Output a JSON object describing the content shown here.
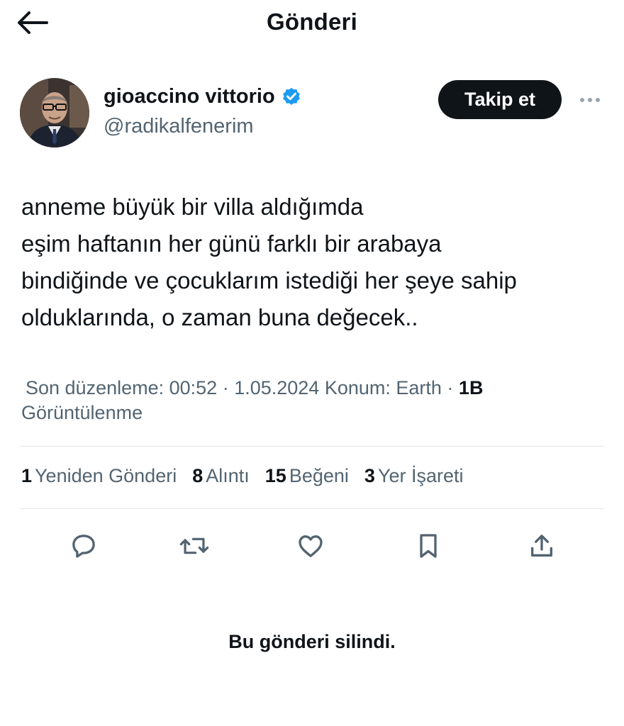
{
  "header": {
    "title": "Gönderi",
    "back_icon": "arrow-left-icon"
  },
  "author": {
    "name": "gioaccino vittorio",
    "handle": "@radikalfenerim",
    "verified_icon": "verified-badge-icon",
    "verified_color": "#1d9bf0",
    "follow_label": "Takip et",
    "more_icon": "more-horizontal-icon"
  },
  "tweet": {
    "lines": [
      "anneme büyük bir villa aldığımda",
      "eşim haftanın her günü farklı bir arabaya",
      "bindiğinde ve çocuklarım istediği her şeye sahip",
      "olduklarında, o zaman buna değecek.."
    ]
  },
  "meta": {
    "edited": "Son düzenleme: 00:52 · 1.05.2024",
    "location": "Konum: Earth ·",
    "views_count": "1B",
    "views_label": "Görüntülenme"
  },
  "stats": [
    {
      "count": "1",
      "label": "Yeniden Gönderi"
    },
    {
      "count": "8",
      "label": "Alıntı"
    },
    {
      "count": "15",
      "label": "Beğeni"
    },
    {
      "count": "3",
      "label": "Yer İşareti"
    }
  ],
  "actions": {
    "icons": [
      "reply-icon",
      "retweet-icon",
      "like-icon",
      "bookmark-icon",
      "share-icon"
    ],
    "icon_color": "#536471"
  },
  "deleted_note": "Bu gönderi silindi."
}
